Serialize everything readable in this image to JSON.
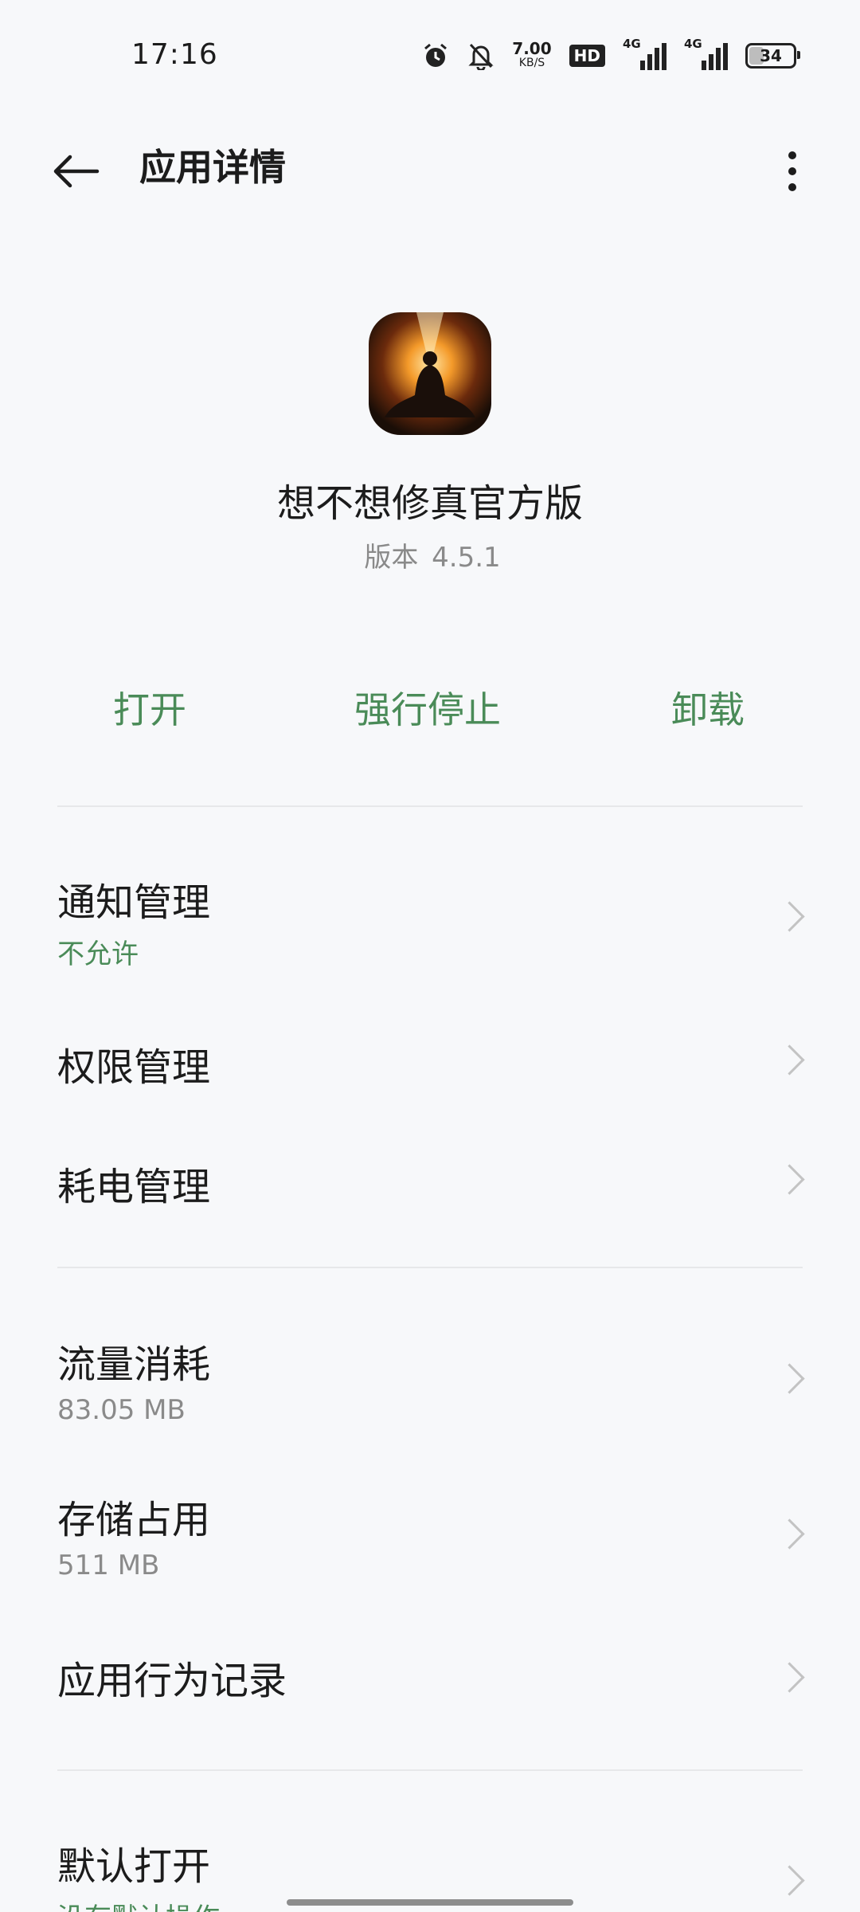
{
  "status_bar": {
    "time": "17:16",
    "net_speed": "7.00",
    "net_speed_unit": "KB/S",
    "hd_label": "HD",
    "sig1_label": "4G",
    "sig2_label": "4G",
    "battery": "34",
    "battery_level": 34,
    "icons": [
      "alarm-icon",
      "bell-off-icon",
      "hd-icon",
      "signal-icon",
      "signal-icon",
      "battery-icon"
    ]
  },
  "header": {
    "title": "应用详情",
    "back_icon": "arrow-left-icon",
    "more_icon": "more-vertical-icon"
  },
  "app": {
    "name": "想不想修真官方版",
    "version_label": "版本",
    "version": "4.5.1"
  },
  "actions": {
    "open": "打开",
    "force_stop": "强行停止",
    "uninstall": "卸载",
    "accent_color": "#4a8b58"
  },
  "settings": [
    {
      "title": "通知管理",
      "subtitle": "不允许"
    },
    {
      "title": "权限管理"
    },
    {
      "title": "耗电管理"
    },
    {
      "title": "流量消耗",
      "subtitle": "83.05 MB"
    },
    {
      "title": "存储占用",
      "subtitle": "511 MB"
    },
    {
      "title": "应用行为记录"
    },
    {
      "title": "默认打开",
      "subtitle": "没有默认操作"
    }
  ]
}
